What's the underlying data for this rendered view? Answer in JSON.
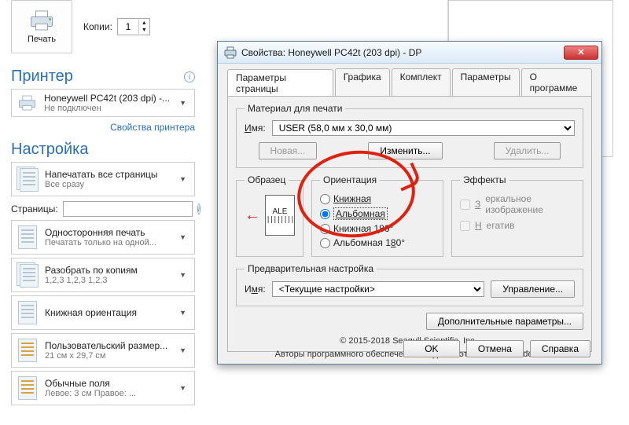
{
  "left": {
    "print": "Печать",
    "copies_label": "Копии:",
    "copies_value": "1",
    "printer_header": "Принтер",
    "printer_name": "Honeywell PC42t (203 dpi) -...",
    "printer_status": "Не подключен",
    "printer_props_link": "Свойства принтера",
    "settings_header": "Настройка",
    "opts": [
      {
        "t1": "Напечатать все страницы",
        "t2": "Все сразу"
      }
    ],
    "pages_label": "Страницы:",
    "opts2": [
      {
        "t1": "Односторонняя печать",
        "t2": "Печатать только на одной..."
      },
      {
        "t1": "Разобрать по копиям",
        "t2": "1,2,3   1,2,3   1,2,3"
      },
      {
        "t1": "Книжная ориентация",
        "t2": ""
      },
      {
        "t1": "Пользовательский размер...",
        "t2": "21 см x 29,7 см"
      },
      {
        "t1": "Обычные поля",
        "t2": "Левое: 3 см   Правое: ..."
      }
    ]
  },
  "dialog": {
    "title": "Свойства: Honeywell PC42t (203 dpi) - DP",
    "tabs": [
      "Параметры страницы",
      "Графика",
      "Комплект",
      "Параметры",
      "О программе"
    ],
    "material": {
      "legend": "Материал для печати",
      "name_label": "Имя:",
      "name_value": "USER (58,0 мм x 30,0 мм)",
      "btn_new": "Новая...",
      "btn_edit": "Изменить...",
      "btn_delete": "Удалить..."
    },
    "sample_legend": "Образец",
    "sample_text": "ALE",
    "orient": {
      "legend": "Ориентация",
      "o1": "Книжная",
      "o2": "Альбомная",
      "o3": "Книжная 180°",
      "o4": "Альбомная 180°"
    },
    "fx": {
      "legend": "Эффекты",
      "mirror": "Зеркальное изображение",
      "neg": "Негатив"
    },
    "preset": {
      "legend": "Предварительная настройка",
      "name_label": "Имя:",
      "name_value": "<Текущие настройки>",
      "btn_manage": "Управление..."
    },
    "btn_adv": "Дополнительные параметры...",
    "credits1": "© 2015-2018 Seagull Scientific, Inc.,",
    "credits2": "Авторы программного обеспечения создания этикеток BarTender®.",
    "ok": "OK",
    "cancel": "Отмена",
    "help": "Справка"
  }
}
